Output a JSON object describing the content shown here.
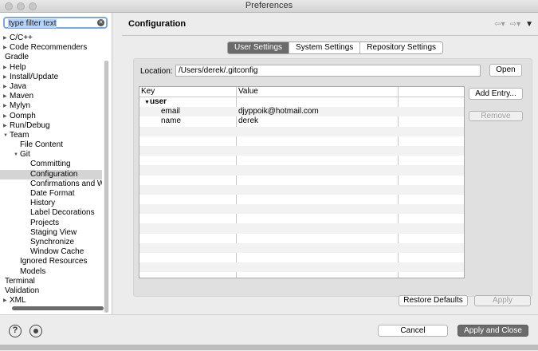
{
  "window": {
    "title": "Preferences"
  },
  "left": {
    "filter_placeholder": "type filter text",
    "tree": [
      {
        "label": "C/C++",
        "indent": 0,
        "twisty": "closed"
      },
      {
        "label": "Code Recommenders",
        "indent": 0,
        "twisty": "closed"
      },
      {
        "label": "Gradle",
        "indent": 0,
        "twisty": "none"
      },
      {
        "label": "Help",
        "indent": 0,
        "twisty": "closed"
      },
      {
        "label": "Install/Update",
        "indent": 0,
        "twisty": "closed"
      },
      {
        "label": "Java",
        "indent": 0,
        "twisty": "closed"
      },
      {
        "label": "Maven",
        "indent": 0,
        "twisty": "closed"
      },
      {
        "label": "Mylyn",
        "indent": 0,
        "twisty": "closed"
      },
      {
        "label": "Oomph",
        "indent": 0,
        "twisty": "closed"
      },
      {
        "label": "Run/Debug",
        "indent": 0,
        "twisty": "closed"
      },
      {
        "label": "Team",
        "indent": 0,
        "twisty": "open"
      },
      {
        "label": "File Content",
        "indent": 1,
        "twisty": "none"
      },
      {
        "label": "Git",
        "indent": 1,
        "twisty": "open"
      },
      {
        "label": "Committing",
        "indent": 2,
        "twisty": "none"
      },
      {
        "label": "Configuration",
        "indent": 2,
        "twisty": "none",
        "selected": true
      },
      {
        "label": "Confirmations and Wa",
        "indent": 2,
        "twisty": "none"
      },
      {
        "label": "Date Format",
        "indent": 2,
        "twisty": "none"
      },
      {
        "label": "History",
        "indent": 2,
        "twisty": "none"
      },
      {
        "label": "Label Decorations",
        "indent": 2,
        "twisty": "none"
      },
      {
        "label": "Projects",
        "indent": 2,
        "twisty": "none"
      },
      {
        "label": "Staging View",
        "indent": 2,
        "twisty": "none"
      },
      {
        "label": "Synchronize",
        "indent": 2,
        "twisty": "none"
      },
      {
        "label": "Window Cache",
        "indent": 2,
        "twisty": "none"
      },
      {
        "label": "Ignored Resources",
        "indent": 1,
        "twisty": "none"
      },
      {
        "label": "Models",
        "indent": 1,
        "twisty": "none"
      },
      {
        "label": "Terminal",
        "indent": 0,
        "twisty": "none"
      },
      {
        "label": "Validation",
        "indent": 0,
        "twisty": "none"
      },
      {
        "label": "XML",
        "indent": 0,
        "twisty": "closed"
      }
    ]
  },
  "main": {
    "title": "Configuration",
    "tabs": [
      {
        "label": "User Settings",
        "active": true
      },
      {
        "label": "System Settings",
        "active": false
      },
      {
        "label": "Repository Settings",
        "active": false
      }
    ],
    "location_label": "Location:",
    "location_value": "/Users/derek/.gitconfig",
    "open_label": "Open",
    "add_entry_label": "Add Entry...",
    "remove_label": "Remove",
    "table": {
      "columns": [
        "Key",
        "Value"
      ],
      "rows": [
        {
          "key": "user",
          "value": "",
          "group": true
        },
        {
          "key": "email",
          "value": "djyppoik@hotmail.com",
          "group": false
        },
        {
          "key": "name",
          "value": "derek",
          "group": false
        }
      ]
    },
    "restore_defaults_label": "Restore Defaults",
    "apply_label": "Apply"
  },
  "footer": {
    "help_glyph": "?",
    "cancel_label": "Cancel",
    "apply_close_label": "Apply and Close"
  }
}
